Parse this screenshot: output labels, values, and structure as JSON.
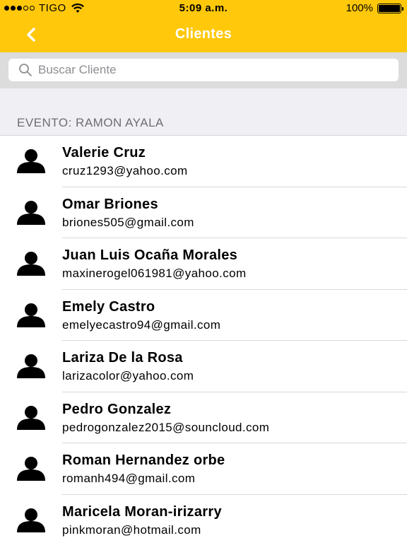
{
  "status_bar": {
    "carrier": "TIGO",
    "time": "5:09 a.m.",
    "battery": "100%",
    "signal_filled": 3,
    "signal_total": 5
  },
  "nav": {
    "title": "Clientes",
    "back_icon": "chevron-left-icon"
  },
  "search": {
    "placeholder": "Buscar Cliente",
    "value": ""
  },
  "section": {
    "header": "EVENTO: RAMON AYALA"
  },
  "clients": [
    {
      "name": "Valerie Cruz",
      "email": "cruz1293@yahoo.com"
    },
    {
      "name": "Omar Briones",
      "email": "briones505@gmail.com"
    },
    {
      "name": "Juan Luis Ocaña Morales",
      "email": "maxinerogel061981@yahoo.com"
    },
    {
      "name": "Emely Castro",
      "email": "emelyecastro94@gmail.com"
    },
    {
      "name": "Lariza De la Rosa",
      "email": "larizacolor@yahoo.com"
    },
    {
      "name": "Pedro Gonzalez",
      "email": "pedrogonzalez2015@souncloud.com"
    },
    {
      "name": "Roman Hernandez orbe",
      "email": "romanh494@gmail.com"
    },
    {
      "name": "Maricela Moran-irizarry",
      "email": "pinkmoran@hotmail.com"
    }
  ],
  "colors": {
    "accent": "#ffc80b",
    "nav_title": "#ffffff",
    "search_bg": "#dcdcdc",
    "section_bg": "#efeff4"
  }
}
